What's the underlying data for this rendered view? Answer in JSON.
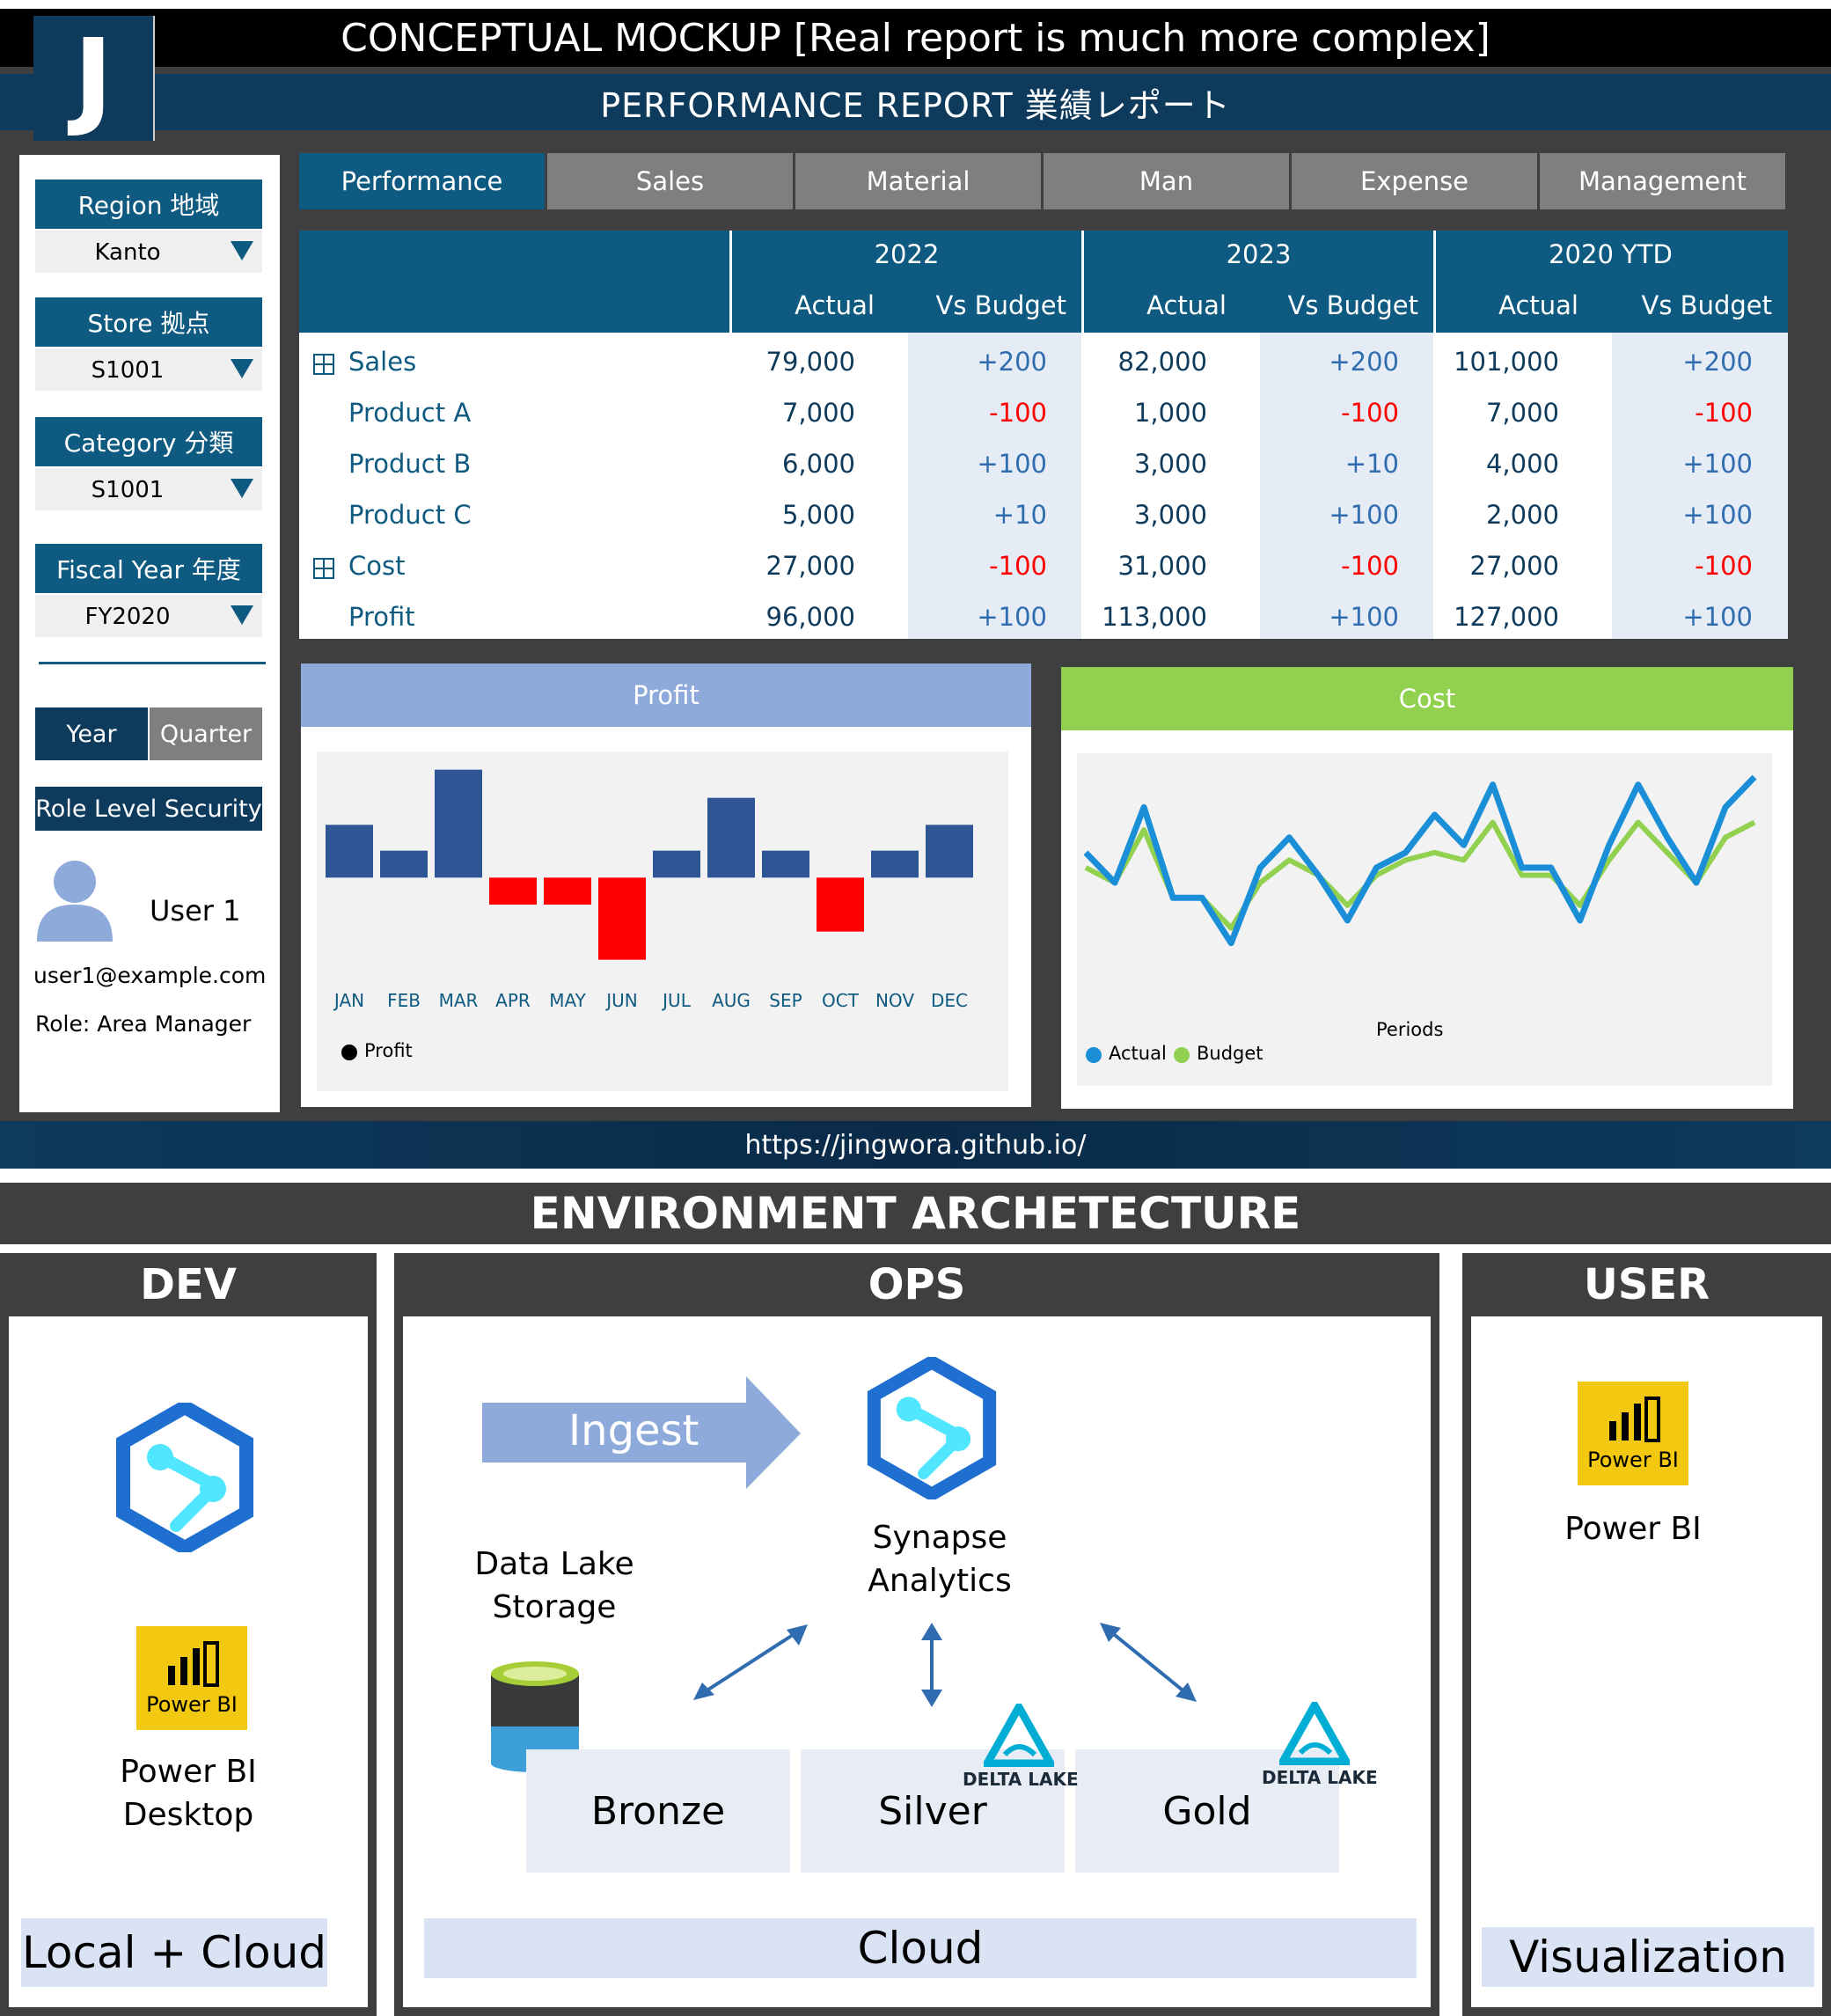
{
  "header": {
    "logo": "J",
    "title": "CONCEPTUAL MOCKUP [Real report is much more complex]",
    "subtitle": "PERFORMANCE REPORT 業績レポート"
  },
  "filters": [
    {
      "label": "Region 地域",
      "value": "Kanto"
    },
    {
      "label": "Store 拠点",
      "value": "S1001"
    },
    {
      "label": "Category 分類",
      "value": "S1001"
    },
    {
      "label": "Fiscal Year 年度",
      "value": "FY2020"
    }
  ],
  "toggle": {
    "year": "Year",
    "quarter": "Quarter"
  },
  "rls": "Role Level Security",
  "user": {
    "name": "User 1",
    "email": "user1@example.com",
    "role": "Role: Area Manager"
  },
  "tabs": [
    "Performance",
    "Sales",
    "Material",
    "Man",
    "Expense",
    "Management"
  ],
  "table": {
    "years": [
      "2022",
      "2023",
      "2020 YTD"
    ],
    "columns": [
      "Actual",
      "Vs Budget",
      "Actual",
      "Vs Budget",
      "Actual",
      "Vs Budget"
    ],
    "rows": [
      {
        "label": "Sales",
        "expand": true,
        "cells": [
          "79,000",
          "+200",
          "82,000",
          "+200",
          "101,000",
          "+200"
        ]
      },
      {
        "label": "Product A",
        "expand": false,
        "cells": [
          "7,000",
          "-100",
          "1,000",
          "-100",
          "7,000",
          "-100"
        ]
      },
      {
        "label": "Product B",
        "expand": false,
        "cells": [
          "6,000",
          "+100",
          "3,000",
          "+10",
          "4,000",
          "+100"
        ]
      },
      {
        "label": "Product C",
        "expand": false,
        "cells": [
          "5,000",
          "+10",
          "3,000",
          "+100",
          "2,000",
          "+100"
        ]
      },
      {
        "label": "Cost",
        "expand": true,
        "cells": [
          "27,000",
          "-100",
          "31,000",
          "-100",
          "27,000",
          "-100"
        ]
      },
      {
        "label": "Profit",
        "expand": false,
        "cells": [
          "96,000",
          "+100",
          "113,000",
          "+100",
          "127,000",
          "+100"
        ]
      }
    ]
  },
  "colors": {
    "positive_bar": "#2f5597",
    "negative_bar": "#ff0000",
    "actual": "#1a8fd8",
    "budget": "#92d050"
  },
  "chart_data": [
    {
      "type": "bar",
      "title": "Profit",
      "categories": [
        "JAN",
        "FEB",
        "MAR",
        "APR",
        "MAY",
        "JUN",
        "JUL",
        "AUG",
        "SEP",
        "OCT",
        "NOV",
        "DEC"
      ],
      "series": [
        {
          "name": "Profit",
          "values": [
            45,
            23,
            92,
            -23,
            -23,
            -70,
            23,
            68,
            23,
            -46,
            23,
            45
          ]
        }
      ],
      "ylim": [
        -80,
        100
      ],
      "legend": "bottom-left"
    },
    {
      "type": "line",
      "title": "Cost",
      "xlabel": "Periods",
      "x": [
        1,
        2,
        3,
        4,
        5,
        6,
        7,
        8,
        9,
        10,
        11,
        12,
        13,
        14,
        15,
        16,
        17,
        18,
        19,
        20,
        21,
        22,
        23,
        24
      ],
      "series": [
        {
          "name": "Actual",
          "values": [
            50,
            30,
            80,
            20,
            20,
            -10,
            40,
            60,
            35,
            5,
            40,
            50,
            75,
            55,
            95,
            40,
            40,
            5,
            55,
            95,
            60,
            30,
            80,
            100
          ]
        },
        {
          "name": "Budget",
          "values": [
            40,
            30,
            65,
            20,
            20,
            0,
            30,
            45,
            35,
            15,
            35,
            45,
            50,
            45,
            70,
            35,
            35,
            15,
            45,
            70,
            50,
            30,
            60,
            70
          ]
        }
      ],
      "ylim": [
        -30,
        110
      ],
      "legend": "bottom-left"
    }
  ],
  "footer": "https://jingwora.github.io/",
  "architecture": {
    "title": "ENVIRONMENT ARCHETECTURE",
    "dev": {
      "title": "DEV",
      "powerbi_label": "Power BI\nDesktop",
      "powerbi_badge": "Power BI",
      "bottom": "Local + Cloud"
    },
    "ops": {
      "title": "OPS",
      "ingest": "Ingest",
      "synapse": "Synapse\nAnalytics",
      "datalake": "Data Lake\nStorage",
      "layers": [
        "Bronze",
        "Silver",
        "Gold"
      ],
      "delta_badge": "DELTA LAKE",
      "bottom": "Cloud"
    },
    "user": {
      "title": "USER",
      "powerbi_badge": "Power BI",
      "powerbi_label": "Power BI",
      "bottom": "Visualization"
    }
  }
}
